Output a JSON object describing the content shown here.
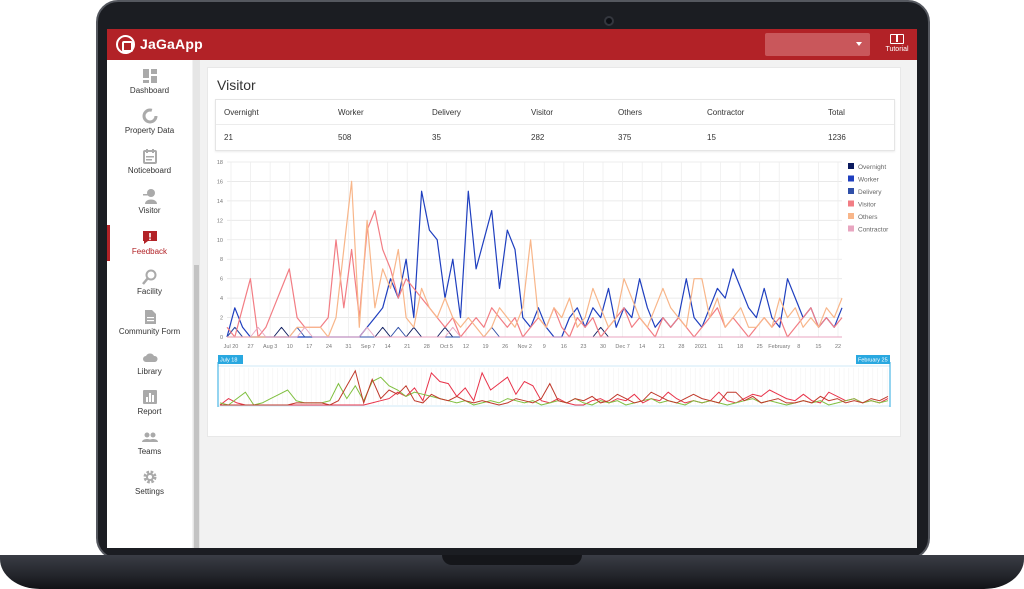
{
  "app": {
    "name": "JaGaApp",
    "tutorial_label": "Tutorial"
  },
  "sidebar": {
    "items": [
      {
        "label": "Dashboard",
        "icon": "dashboard-icon"
      },
      {
        "label": "Property Data",
        "icon": "property-data-icon"
      },
      {
        "label": "Noticeboard",
        "icon": "noticeboard-icon"
      },
      {
        "label": "Visitor",
        "icon": "visitor-icon"
      },
      {
        "label": "Feedback",
        "icon": "feedback-icon",
        "active": true
      },
      {
        "label": "Facility",
        "icon": "facility-icon"
      },
      {
        "label": "Community Form",
        "icon": "community-form-icon"
      },
      {
        "label": "Library",
        "icon": "library-icon"
      },
      {
        "label": "Report",
        "icon": "report-icon"
      },
      {
        "label": "Teams",
        "icon": "teams-icon"
      },
      {
        "label": "Settings",
        "icon": "settings-icon"
      }
    ]
  },
  "page": {
    "title": "Visitor"
  },
  "stats": {
    "headers": [
      "Overnight",
      "Worker",
      "Delivery",
      "Visitor",
      "Others",
      "Contractor",
      "Total"
    ],
    "values": [
      "21",
      "508",
      "35",
      "282",
      "375",
      "15",
      "1236"
    ]
  },
  "colors": {
    "brand": "#b22227",
    "overnight": "#0b1a5e",
    "worker": "#1f3fbf",
    "delivery": "#2f4fa8",
    "visitor": "#f27d84",
    "others": "#f8b68a",
    "contractor": "#e8a6c0"
  },
  "chart_data": {
    "type": "line",
    "ylim": [
      0,
      18
    ],
    "y_ticks": [
      "0",
      "2",
      "4",
      "6",
      "8",
      "10",
      "12",
      "14",
      "16",
      "18"
    ],
    "x_ticks": [
      "Jul 20",
      "27",
      "Aug 3",
      "10",
      "17",
      "24",
      "31",
      "Sep 7",
      "14",
      "21",
      "28",
      "Oct 5",
      "12",
      "19",
      "26",
      "Nov 2",
      "9",
      "16",
      "23",
      "30",
      "Dec 7",
      "14",
      "21",
      "28",
      "2021",
      "11",
      "18",
      "25",
      "February",
      "8",
      "15",
      "22"
    ],
    "legend": [
      "Overnight",
      "Worker",
      "Delivery",
      "Visitor",
      "Others",
      "Contractor"
    ],
    "range_start_label": "July 18",
    "range_end_label": "February 25",
    "series": [
      {
        "name": "Overnight",
        "values": [
          0,
          1,
          0,
          0,
          0,
          0,
          0,
          1,
          0,
          0,
          0,
          0,
          0,
          0,
          0,
          0,
          0,
          0,
          0,
          0,
          1,
          0,
          0,
          0,
          1,
          0,
          0,
          0,
          1,
          0,
          0,
          0,
          0,
          0,
          0,
          0,
          0,
          0,
          0,
          0,
          0,
          0,
          0,
          0,
          0,
          0,
          0,
          0,
          1,
          0,
          0,
          0,
          0,
          0,
          0,
          0,
          0,
          0,
          0,
          0,
          0,
          0,
          0,
          0,
          0,
          0,
          0,
          0,
          0,
          0,
          0,
          0,
          0,
          0,
          0,
          0,
          0,
          0,
          0,
          0
        ]
      },
      {
        "name": "Worker",
        "values": [
          0,
          3,
          1,
          0,
          0,
          0,
          0,
          0,
          0,
          0,
          0,
          0,
          0,
          0,
          0,
          0,
          0,
          0,
          1,
          2,
          3,
          6,
          4,
          8,
          2,
          15,
          11,
          10,
          4,
          8,
          2,
          15,
          7,
          10,
          13,
          5,
          11,
          9,
          2,
          1,
          3,
          1,
          0,
          0,
          2,
          3,
          1,
          3,
          2,
          5,
          1,
          3,
          2,
          6,
          3,
          1,
          2,
          1,
          2,
          6,
          2,
          1,
          3,
          5,
          4,
          7,
          5,
          3,
          2,
          5,
          2,
          1,
          6,
          4,
          2,
          3,
          1,
          2,
          1,
          3
        ]
      },
      {
        "name": "Delivery",
        "values": [
          0,
          1,
          0,
          0,
          0,
          0,
          0,
          0,
          0,
          1,
          0,
          0,
          0,
          0,
          0,
          0,
          0,
          0,
          0,
          0,
          0,
          0,
          1,
          0,
          0,
          0,
          0,
          0,
          0,
          0,
          0,
          0,
          0,
          0,
          1,
          0,
          0,
          0,
          0,
          0,
          0,
          0,
          0,
          0,
          0,
          0,
          0,
          0,
          0,
          0,
          0,
          0,
          0,
          0,
          0,
          0,
          0,
          0,
          0,
          0,
          0,
          0,
          0,
          0,
          0,
          0,
          0,
          0,
          0,
          0,
          0,
          0,
          0,
          0,
          0,
          0,
          0,
          0,
          0,
          0
        ]
      },
      {
        "name": "Visitor",
        "values": [
          1,
          0,
          3,
          6,
          0,
          1,
          3,
          5,
          7,
          2,
          1,
          1,
          1,
          2,
          10,
          3,
          9,
          2,
          11,
          13,
          9,
          7,
          4,
          6,
          5,
          4,
          3,
          2,
          1,
          2,
          0,
          1,
          2,
          1,
          3,
          2,
          1,
          2,
          0,
          1,
          2,
          1,
          3,
          1,
          0,
          2,
          1,
          2,
          0,
          1,
          2,
          3,
          1,
          2,
          1,
          0,
          2,
          1,
          2,
          1,
          0,
          1,
          2,
          3,
          1,
          2,
          1,
          0,
          1,
          2,
          1,
          2,
          0,
          1,
          2,
          3,
          1,
          2,
          1,
          2
        ]
      },
      {
        "name": "Others",
        "values": [
          0,
          0,
          0,
          0,
          0,
          0,
          0,
          0,
          0,
          1,
          1,
          1,
          1,
          0,
          2,
          9,
          16,
          1,
          12,
          3,
          7,
          5,
          9,
          2,
          1,
          5,
          3,
          2,
          4,
          2,
          1,
          2,
          1,
          0,
          1,
          3,
          2,
          1,
          3,
          10,
          2,
          1,
          3,
          2,
          4,
          1,
          2,
          5,
          3,
          1,
          2,
          6,
          4,
          2,
          1,
          3,
          5,
          3,
          2,
          1,
          6,
          6,
          2,
          4,
          1,
          2,
          3,
          1,
          1,
          2,
          1,
          4,
          2,
          3,
          1,
          2,
          1,
          3,
          2,
          4
        ]
      },
      {
        "name": "Contractor",
        "values": [
          0,
          0,
          0,
          0,
          1,
          0,
          0,
          0,
          0,
          0,
          1,
          0,
          0,
          0,
          0,
          0,
          0,
          0,
          1,
          0,
          0,
          0,
          0,
          0,
          0,
          0,
          0,
          0,
          0,
          1,
          0,
          0,
          0,
          0,
          0,
          0,
          0,
          0,
          0,
          0,
          0,
          0,
          0,
          0,
          0,
          0,
          0,
          0,
          0,
          0,
          0,
          0,
          0,
          0,
          0,
          0,
          0,
          0,
          0,
          0,
          0,
          0,
          0,
          0,
          0,
          0,
          0,
          0,
          0,
          0,
          0,
          0,
          0,
          0,
          0,
          0,
          0,
          0,
          0,
          0
        ]
      }
    ]
  }
}
